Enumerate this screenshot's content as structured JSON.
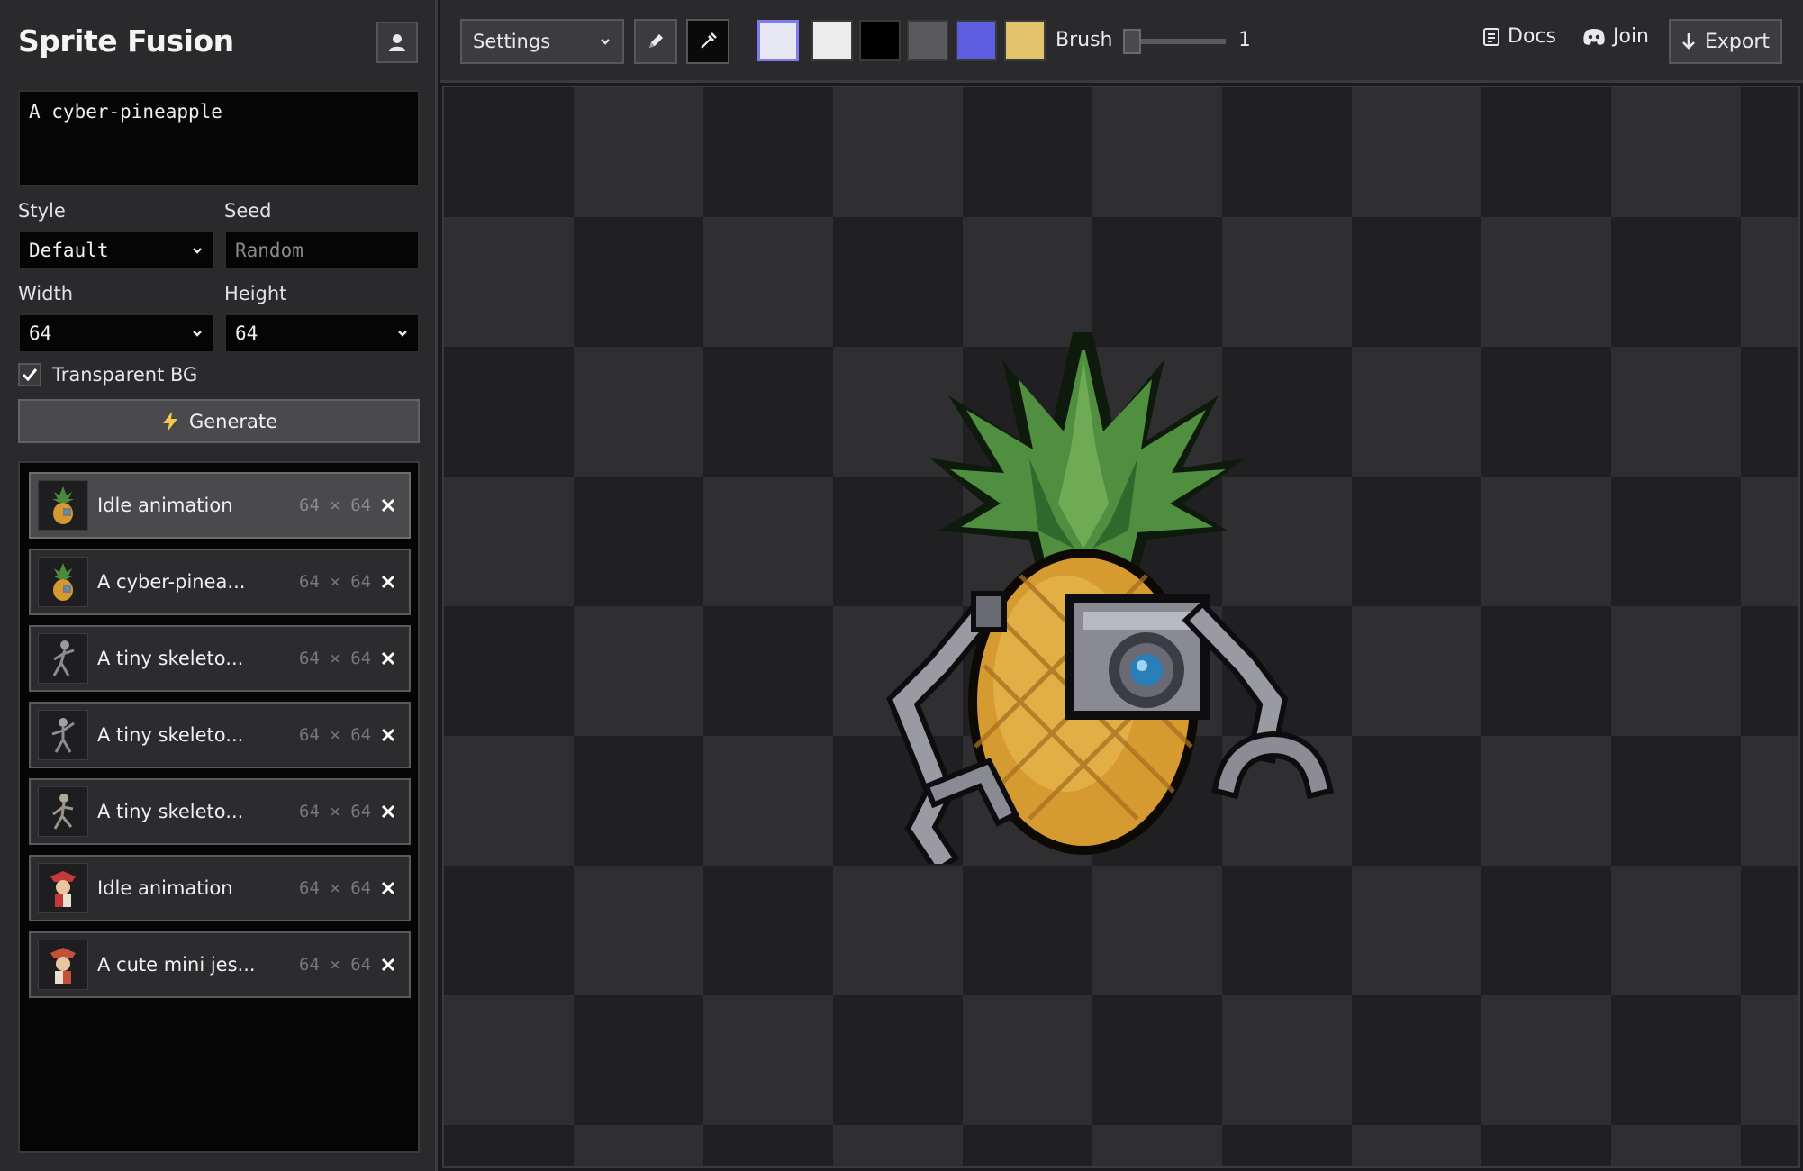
{
  "app": {
    "title": "Sprite Fusion"
  },
  "prompt": {
    "value": "A cyber-pineapple"
  },
  "style": {
    "label": "Style",
    "value": "Default"
  },
  "seed": {
    "label": "Seed",
    "placeholder": "Random"
  },
  "width": {
    "label": "Width",
    "value": "64"
  },
  "height": {
    "label": "Height",
    "value": "64"
  },
  "transparent_bg": {
    "label": "Transparent BG",
    "checked": true
  },
  "generate": {
    "label": "Generate"
  },
  "history": [
    {
      "label": "Idle animation",
      "size": "64 × 64",
      "thumb": "pineapple-thumb",
      "active": true
    },
    {
      "label": "A cyber-pinea...",
      "size": "64 × 64",
      "thumb": "pineapple-thumb"
    },
    {
      "label": "A tiny skeleto...",
      "size": "64 × 64",
      "thumb": "skeleton-thumb"
    },
    {
      "label": "A tiny skeleto...",
      "size": "64 × 64",
      "thumb": "skeleton-thumb"
    },
    {
      "label": "A tiny skeleto...",
      "size": "64 × 64",
      "thumb": "skeleton-thumb"
    },
    {
      "label": "Idle animation",
      "size": "64 × 64",
      "thumb": "jester-thumb"
    },
    {
      "label": "A cute mini jes...",
      "size": "64 × 64",
      "thumb": "jester-thumb"
    }
  ],
  "toolbar": {
    "settings_label": "Settings",
    "swatches": [
      "#e8e8f4",
      "#ececec",
      "#000000",
      "#5a5a5c",
      "#5e5ee0",
      "#e3c26c"
    ],
    "brush_label": "Brush",
    "brush_value": "1",
    "docs_label": "Docs",
    "join_label": "Join",
    "export_label": "Export"
  }
}
